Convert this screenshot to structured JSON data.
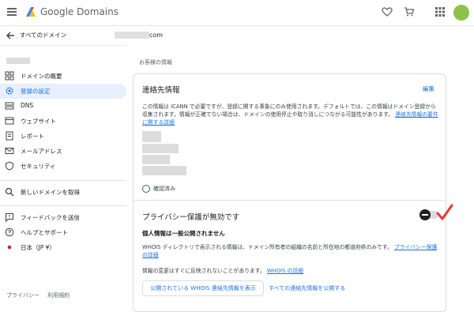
{
  "header": {
    "brand": "Google Domains",
    "icons": [
      "menu-icon",
      "google-domains-logo",
      "heart-icon",
      "cart-icon",
      "apps-icon",
      "avatar"
    ]
  },
  "sidebar": {
    "back_label": "すべてのドメイン",
    "items": [
      {
        "label": "ドメインの概要",
        "icon": "overview-icon",
        "active": false
      },
      {
        "label": "登録の設定",
        "icon": "gear-icon",
        "active": true
      },
      {
        "label": "DNS",
        "icon": "dns-icon",
        "active": false
      },
      {
        "label": "ウェブサイト",
        "icon": "website-icon",
        "active": false
      },
      {
        "label": "レポート",
        "icon": "report-icon",
        "active": false
      },
      {
        "label": "メールアドレス",
        "icon": "mail-icon",
        "active": false
      },
      {
        "label": "セキュリティ",
        "icon": "shield-icon",
        "active": false
      }
    ],
    "get_new_domain": "新しいドメインを取得",
    "feedback": "フィードバックを送信",
    "help": "ヘルプとサポート",
    "locale": "日本（JP ¥）",
    "footer_links": [
      "プライバシー",
      "利用規約"
    ]
  },
  "main": {
    "domain_suffix": "com",
    "section_label": "お客様の情報",
    "contact": {
      "title": "連絡先情報",
      "edit": "編集",
      "description": "この情報は ICANN で必要ですが、登録に関する事象にのみ使用されます。デフォルトでは、この情報はドメイン登録から収集されます。情報が正確でない場合は、ドメインの使用停止や取り消しにつながる可能性があります。",
      "link": "連絡先情報の要件に関する詳細",
      "verified": "確認済み"
    },
    "privacy": {
      "title": "プライバシー保護が無効です",
      "toggle_on": false,
      "bold_note": "個人情報は一般公開されません",
      "description": "WHOIS ディレクトリで表示される情報は、ドメイン所有者の組織の名前と所在地の都道府県のみです。",
      "link": "プライバシー保護の詳細",
      "note": "情報の変更はすぐに反映されないことがあります。",
      "note_link": "WHOIS の詳細",
      "button": "公開されている WHOIS 連絡先情報を表示",
      "text_button": "すべての連絡先情報を公開する"
    }
  },
  "colors": {
    "accent": "#1a73e8",
    "active_bg": "#e8f0fe",
    "annotation": "#e53935"
  }
}
